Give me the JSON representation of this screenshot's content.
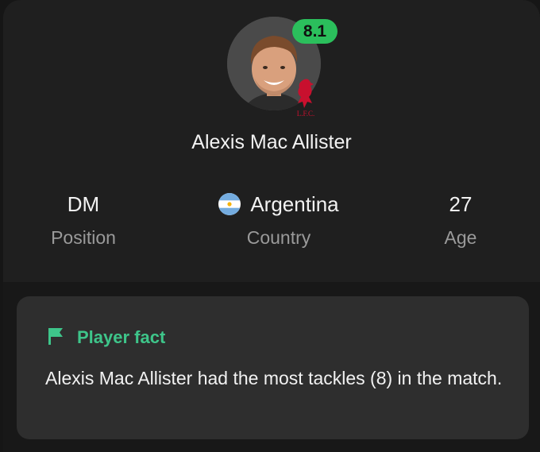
{
  "player": {
    "name": "Alexis Mac Allister",
    "rating": "8.1",
    "club_badge_text": "L.F.C."
  },
  "stats": {
    "position": {
      "value": "DM",
      "label": "Position"
    },
    "country": {
      "value": "Argentina",
      "label": "Country",
      "flag_icon": "argentina-flag-icon"
    },
    "age": {
      "value": "27",
      "label": "Age"
    }
  },
  "fact": {
    "title": "Player fact",
    "icon": "flag-icon",
    "text": "Alexis Mac Allister had the most tackles (8) in the match."
  },
  "colors": {
    "rating_badge": "#2bbf5c",
    "fact_accent": "#3ec58a",
    "card_background": "#1f1f1f"
  }
}
